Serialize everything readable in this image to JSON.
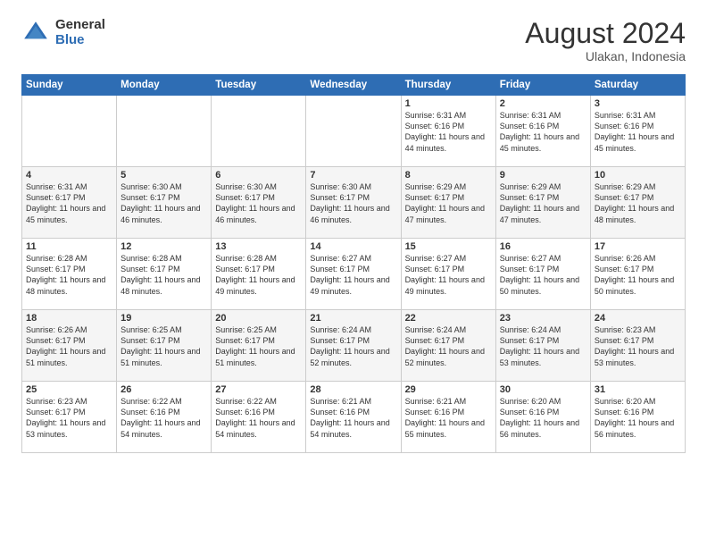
{
  "logo": {
    "general": "General",
    "blue": "Blue"
  },
  "header": {
    "month_year": "August 2024",
    "location": "Ulakan, Indonesia"
  },
  "weekdays": [
    "Sunday",
    "Monday",
    "Tuesday",
    "Wednesday",
    "Thursday",
    "Friday",
    "Saturday"
  ],
  "weeks": [
    [
      {
        "day": "",
        "sunrise": "",
        "sunset": "",
        "daylight": ""
      },
      {
        "day": "",
        "sunrise": "",
        "sunset": "",
        "daylight": ""
      },
      {
        "day": "",
        "sunrise": "",
        "sunset": "",
        "daylight": ""
      },
      {
        "day": "",
        "sunrise": "",
        "sunset": "",
        "daylight": ""
      },
      {
        "day": "1",
        "sunrise": "6:31 AM",
        "sunset": "6:16 PM",
        "daylight": "11 hours and 44 minutes."
      },
      {
        "day": "2",
        "sunrise": "6:31 AM",
        "sunset": "6:16 PM",
        "daylight": "11 hours and 45 minutes."
      },
      {
        "day": "3",
        "sunrise": "6:31 AM",
        "sunset": "6:16 PM",
        "daylight": "11 hours and 45 minutes."
      }
    ],
    [
      {
        "day": "4",
        "sunrise": "6:31 AM",
        "sunset": "6:17 PM",
        "daylight": "11 hours and 45 minutes."
      },
      {
        "day": "5",
        "sunrise": "6:30 AM",
        "sunset": "6:17 PM",
        "daylight": "11 hours and 46 minutes."
      },
      {
        "day": "6",
        "sunrise": "6:30 AM",
        "sunset": "6:17 PM",
        "daylight": "11 hours and 46 minutes."
      },
      {
        "day": "7",
        "sunrise": "6:30 AM",
        "sunset": "6:17 PM",
        "daylight": "11 hours and 46 minutes."
      },
      {
        "day": "8",
        "sunrise": "6:29 AM",
        "sunset": "6:17 PM",
        "daylight": "11 hours and 47 minutes."
      },
      {
        "day": "9",
        "sunrise": "6:29 AM",
        "sunset": "6:17 PM",
        "daylight": "11 hours and 47 minutes."
      },
      {
        "day": "10",
        "sunrise": "6:29 AM",
        "sunset": "6:17 PM",
        "daylight": "11 hours and 48 minutes."
      }
    ],
    [
      {
        "day": "11",
        "sunrise": "6:28 AM",
        "sunset": "6:17 PM",
        "daylight": "11 hours and 48 minutes."
      },
      {
        "day": "12",
        "sunrise": "6:28 AM",
        "sunset": "6:17 PM",
        "daylight": "11 hours and 48 minutes."
      },
      {
        "day": "13",
        "sunrise": "6:28 AM",
        "sunset": "6:17 PM",
        "daylight": "11 hours and 49 minutes."
      },
      {
        "day": "14",
        "sunrise": "6:27 AM",
        "sunset": "6:17 PM",
        "daylight": "11 hours and 49 minutes."
      },
      {
        "day": "15",
        "sunrise": "6:27 AM",
        "sunset": "6:17 PM",
        "daylight": "11 hours and 49 minutes."
      },
      {
        "day": "16",
        "sunrise": "6:27 AM",
        "sunset": "6:17 PM",
        "daylight": "11 hours and 50 minutes."
      },
      {
        "day": "17",
        "sunrise": "6:26 AM",
        "sunset": "6:17 PM",
        "daylight": "11 hours and 50 minutes."
      }
    ],
    [
      {
        "day": "18",
        "sunrise": "6:26 AM",
        "sunset": "6:17 PM",
        "daylight": "11 hours and 51 minutes."
      },
      {
        "day": "19",
        "sunrise": "6:25 AM",
        "sunset": "6:17 PM",
        "daylight": "11 hours and 51 minutes."
      },
      {
        "day": "20",
        "sunrise": "6:25 AM",
        "sunset": "6:17 PM",
        "daylight": "11 hours and 51 minutes."
      },
      {
        "day": "21",
        "sunrise": "6:24 AM",
        "sunset": "6:17 PM",
        "daylight": "11 hours and 52 minutes."
      },
      {
        "day": "22",
        "sunrise": "6:24 AM",
        "sunset": "6:17 PM",
        "daylight": "11 hours and 52 minutes."
      },
      {
        "day": "23",
        "sunrise": "6:24 AM",
        "sunset": "6:17 PM",
        "daylight": "11 hours and 53 minutes."
      },
      {
        "day": "24",
        "sunrise": "6:23 AM",
        "sunset": "6:17 PM",
        "daylight": "11 hours and 53 minutes."
      }
    ],
    [
      {
        "day": "25",
        "sunrise": "6:23 AM",
        "sunset": "6:17 PM",
        "daylight": "11 hours and 53 minutes."
      },
      {
        "day": "26",
        "sunrise": "6:22 AM",
        "sunset": "6:16 PM",
        "daylight": "11 hours and 54 minutes."
      },
      {
        "day": "27",
        "sunrise": "6:22 AM",
        "sunset": "6:16 PM",
        "daylight": "11 hours and 54 minutes."
      },
      {
        "day": "28",
        "sunrise": "6:21 AM",
        "sunset": "6:16 PM",
        "daylight": "11 hours and 54 minutes."
      },
      {
        "day": "29",
        "sunrise": "6:21 AM",
        "sunset": "6:16 PM",
        "daylight": "11 hours and 55 minutes."
      },
      {
        "day": "30",
        "sunrise": "6:20 AM",
        "sunset": "6:16 PM",
        "daylight": "11 hours and 56 minutes."
      },
      {
        "day": "31",
        "sunrise": "6:20 AM",
        "sunset": "6:16 PM",
        "daylight": "11 hours and 56 minutes."
      }
    ]
  ]
}
